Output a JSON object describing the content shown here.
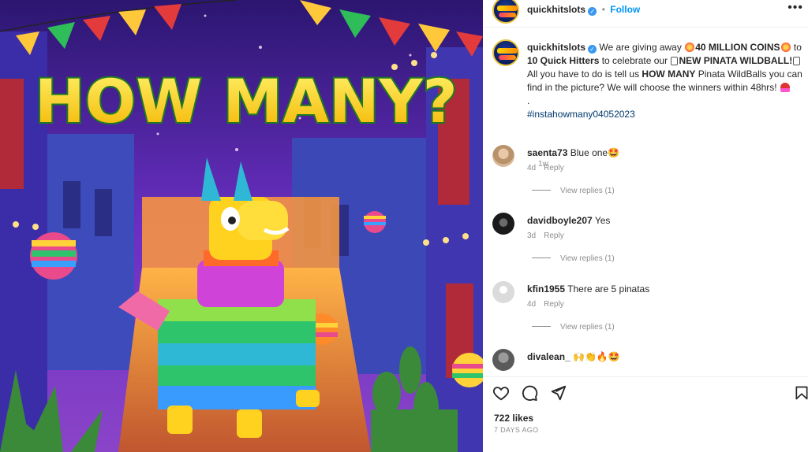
{
  "account": {
    "username": "quickhitslots",
    "follow_label": "Follow",
    "more_label": "•••"
  },
  "caption": {
    "username": "quickhitslots",
    "line1_prefix": " We are giving away ",
    "coins": "40 MILLION COINS",
    "line1_suffix": " to",
    "quick_hitters": "10 Quick Hitters",
    "mid_text": " to celebrate our ",
    "pinata": "NEW PINATA WILDBALL!",
    "line3_prefix": "All you have to do is tell us ",
    "how_many": "HOW MANY",
    "line3_suffix": " Pinata WildBalls you can find in the picture? We will choose the winners within 48hrs! ",
    "dot": ".",
    "hashtag": "#instahowmany04052023",
    "time": "1w"
  },
  "artwork": {
    "headline": "HOW MANY?"
  },
  "comments": [
    {
      "username": "saenta73",
      "text": "Blue one🤩",
      "age": "4d",
      "reply_label": "Reply",
      "replies_label": "View replies (1)"
    },
    {
      "username": "davidboyle207",
      "text": "Yes",
      "age": "3d",
      "reply_label": "Reply",
      "replies_label": "View replies (1)"
    },
    {
      "username": "kfin1955",
      "text": "There are 5 pinatas",
      "age": "4d",
      "reply_label": "Reply",
      "replies_label": "View replies (1)"
    },
    {
      "username": "divalean_",
      "text": "🙌👏🔥🤩",
      "age": "",
      "reply_label": "",
      "replies_label": ""
    }
  ],
  "footer": {
    "likes": "722 likes",
    "date": "7 DAYS AGO"
  },
  "icons": [
    "heart-icon",
    "comment-icon",
    "share-icon",
    "bookmark-icon",
    "verified-badge-icon",
    "more-options-icon"
  ],
  "colors": {
    "link_blue": "#0095f6",
    "verified_blue": "#3897f0",
    "hashtag_blue": "#00376b",
    "muted_gray": "#8e8e8e",
    "headline_yellow": "#ffd21f",
    "headline_green": "#2e9b2e"
  }
}
